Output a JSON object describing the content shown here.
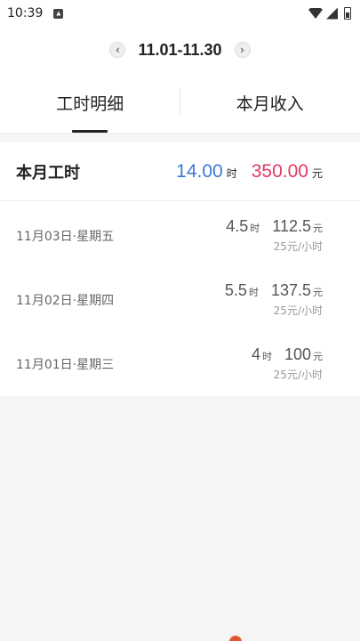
{
  "status_bar": {
    "time": "10:39"
  },
  "period": {
    "text": "11.01-11.30"
  },
  "tabs": [
    {
      "label": "工时明细"
    },
    {
      "label": "本月收入"
    }
  ],
  "summary": {
    "label": "本月工时",
    "hours": "14.00",
    "hours_unit": "时",
    "income": "350.00",
    "income_unit": "元"
  },
  "entries": [
    {
      "date": "11月03日·星期五",
      "hours": "4.5",
      "hours_unit": "时",
      "amount": "112.5",
      "amount_unit": "元",
      "rate": "25元/小时"
    },
    {
      "date": "11月02日·星期四",
      "hours": "5.5",
      "hours_unit": "时",
      "amount": "137.5",
      "amount_unit": "元",
      "rate": "25元/小时"
    },
    {
      "date": "11月01日·星期三",
      "hours": "4",
      "hours_unit": "时",
      "amount": "100",
      "amount_unit": "元",
      "rate": "25元/小时"
    }
  ],
  "colors": {
    "hours": "#3a78d8",
    "income": "#e23a63",
    "accent_dot": "#e2562f"
  }
}
